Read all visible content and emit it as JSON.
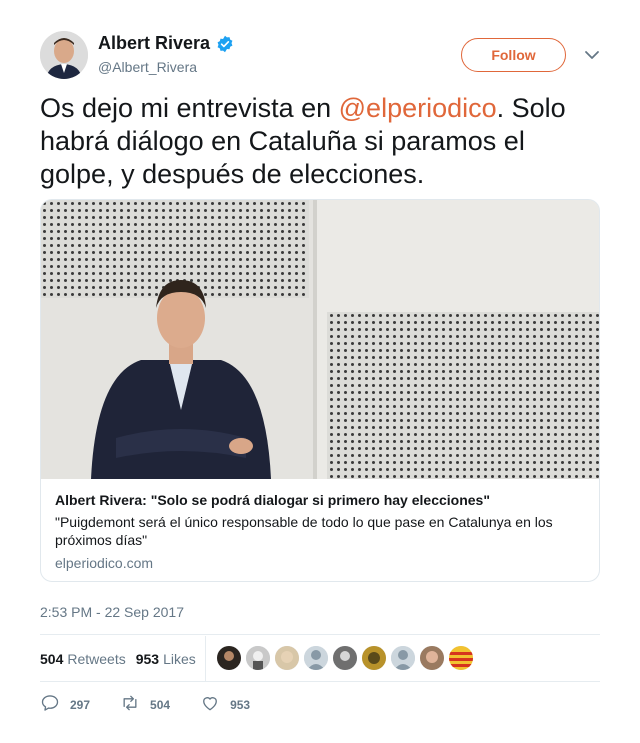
{
  "author": {
    "name": "Albert Rivera",
    "handle": "@Albert_Rivera",
    "verified": true,
    "avatar_icon": "user-avatar"
  },
  "follow_label": "Follow",
  "tweet": {
    "text_before": "Os dejo mi entrevista en ",
    "mention": "@elperiodico",
    "text_after": ". Solo habrá diálogo en Cataluña si paramos el golpe, y después de elecciones."
  },
  "card": {
    "title": "Albert Rivera: \"Solo se podrá dialogar si primero hay elecciones\"",
    "description": "\"Puigdemont será el único responsable de todo lo que pase en Catalunya en los próximos días\"",
    "domain": "elperiodico.com"
  },
  "timestamp": "2:53 PM - 22 Sep 2017",
  "stats": {
    "retweets_count": "504",
    "retweets_label": "Retweets",
    "likes_count": "953",
    "likes_label": "Likes"
  },
  "actions": {
    "reply_count": "297",
    "retweet_count": "504",
    "like_count": "953"
  },
  "colors": {
    "accent": "#e0673a",
    "verified": "#1da1f2",
    "muted": "#657786"
  }
}
